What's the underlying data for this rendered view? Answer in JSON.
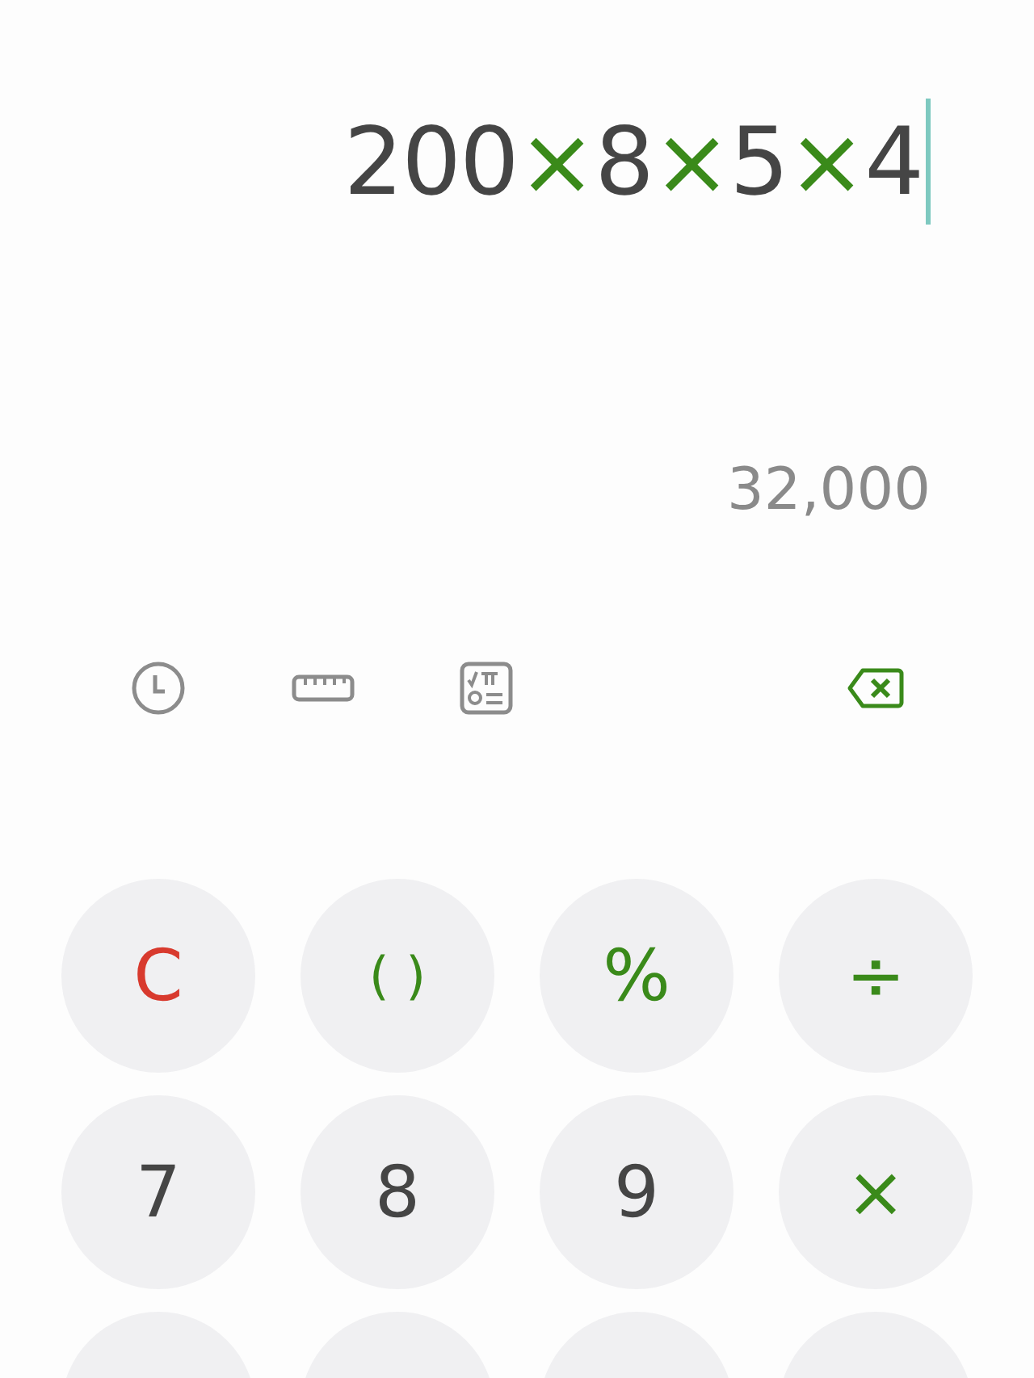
{
  "expression": [
    {
      "text": "200",
      "kind": "number"
    },
    {
      "text": "×",
      "kind": "operator"
    },
    {
      "text": "8",
      "kind": "number"
    },
    {
      "text": "×",
      "kind": "operator"
    },
    {
      "text": "5",
      "kind": "number"
    },
    {
      "text": "×",
      "kind": "operator"
    },
    {
      "text": "4",
      "kind": "number"
    }
  ],
  "result": "32,000",
  "keys": [
    [
      {
        "label": "C",
        "kind": "clear"
      },
      {
        "label": "( )",
        "kind": "function"
      },
      {
        "label": "%",
        "kind": "function"
      },
      {
        "label": "÷",
        "kind": "operator"
      }
    ],
    [
      {
        "label": "7",
        "kind": "digit"
      },
      {
        "label": "8",
        "kind": "digit"
      },
      {
        "label": "9",
        "kind": "digit"
      },
      {
        "label": "×",
        "kind": "operator"
      }
    ]
  ]
}
